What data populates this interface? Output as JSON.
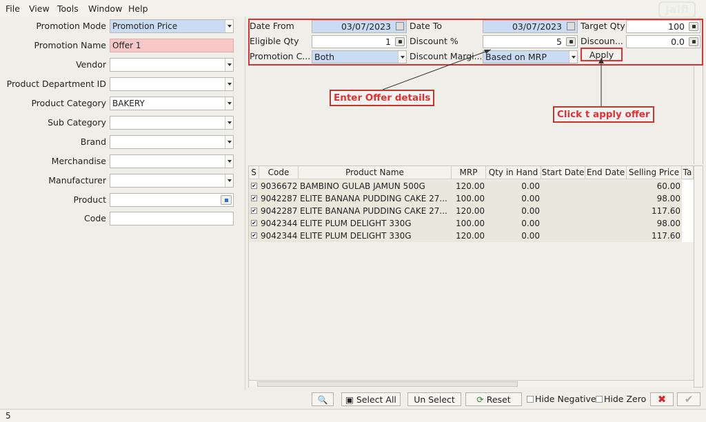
{
  "menu": {
    "file": "File",
    "view": "View",
    "tools": "Tools",
    "window": "Window",
    "help": "Help"
  },
  "filters": [
    {
      "label": "Promotion Mode",
      "value": "Promotion Price",
      "style": "blue",
      "control": "dropdown"
    },
    {
      "label": "Promotion Name",
      "value": "Offer 1",
      "style": "pink",
      "control": "none"
    },
    {
      "label": "Vendor",
      "value": "",
      "style": "",
      "control": "dropdown"
    },
    {
      "label": "Product Department ID",
      "value": "",
      "style": "",
      "control": "dropdown"
    },
    {
      "label": "Product Category",
      "value": "BAKERY",
      "style": "",
      "control": "dropdown"
    },
    {
      "label": "Sub Category",
      "value": "",
      "style": "",
      "control": "dropdown"
    },
    {
      "label": "Brand",
      "value": "",
      "style": "",
      "control": "dropdown"
    },
    {
      "label": "Merchandise",
      "value": "",
      "style": "",
      "control": "dropdown"
    },
    {
      "label": "Manufacturer",
      "value": "",
      "style": "",
      "control": "dropdown"
    },
    {
      "label": "Product",
      "value": "",
      "style": "",
      "control": "search"
    },
    {
      "label": "Code",
      "value": "",
      "style": "",
      "control": "none"
    }
  ],
  "offer": {
    "date_from_label": "Date From",
    "date_from": "03/07/2023",
    "date_to_label": "Date To",
    "date_to": "03/07/2023",
    "target_qty_label": "Target Qty",
    "target_qty": "100",
    "eligible_qty_label": "Eligible Qty",
    "eligible_qty": "1",
    "discount_pct_label": "Discount %",
    "discount_pct": "5",
    "discount_label": "Discoun...",
    "discount": "0.0",
    "promotion_c_label": "Promotion C...",
    "promotion_c": "Both",
    "discount_margin_label": "Discount Margi...",
    "discount_margin": "Based on MRP",
    "apply": "Apply"
  },
  "callouts": {
    "enter_offer": "Enter Offer details",
    "click_apply": "Click t apply offer"
  },
  "logo_text": "Jalfi",
  "grid": {
    "headers": [
      "S",
      "Code",
      "Product Name",
      "MRP",
      "Qty in Hand",
      "Start Date",
      "End Date",
      "Selling Price",
      "Ta"
    ],
    "rows": [
      {
        "code": "9036672",
        "name": "BAMBINO GULAB JAMUN 500G",
        "mrp": "120.00",
        "qty": "0.00",
        "start": "",
        "end": "",
        "price": "60.00",
        "checked": "✔"
      },
      {
        "code": "9042287",
        "name": "ELITE BANANA PUDDING CAKE 27...",
        "mrp": "100.00",
        "qty": "0.00",
        "start": "",
        "end": "",
        "price": "98.00",
        "checked": "✔"
      },
      {
        "code": "9042287",
        "name": "ELITE BANANA PUDDING CAKE 27...",
        "mrp": "120.00",
        "qty": "0.00",
        "start": "",
        "end": "",
        "price": "117.60",
        "checked": "✔"
      },
      {
        "code": "9042344",
        "name": "ELITE PLUM DELIGHT 330G",
        "mrp": "100.00",
        "qty": "0.00",
        "start": "",
        "end": "",
        "price": "98.00",
        "checked": "✔"
      },
      {
        "code": "9042344",
        "name": "ELITE PLUM DELIGHT 330G",
        "mrp": "120.00",
        "qty": "0.00",
        "start": "",
        "end": "",
        "price": "117.60",
        "checked": "✔"
      }
    ]
  },
  "bottom": {
    "select_all": "Select All",
    "un_select": "Un Select",
    "reset": "Reset",
    "hide_negative": "Hide Negative",
    "hide_zero": "Hide Zero"
  },
  "status_text": "5",
  "colors": {
    "highlight_red": "#e03131",
    "blue_field": "#c9dcf3",
    "pink_field": "#f7c8c8"
  }
}
